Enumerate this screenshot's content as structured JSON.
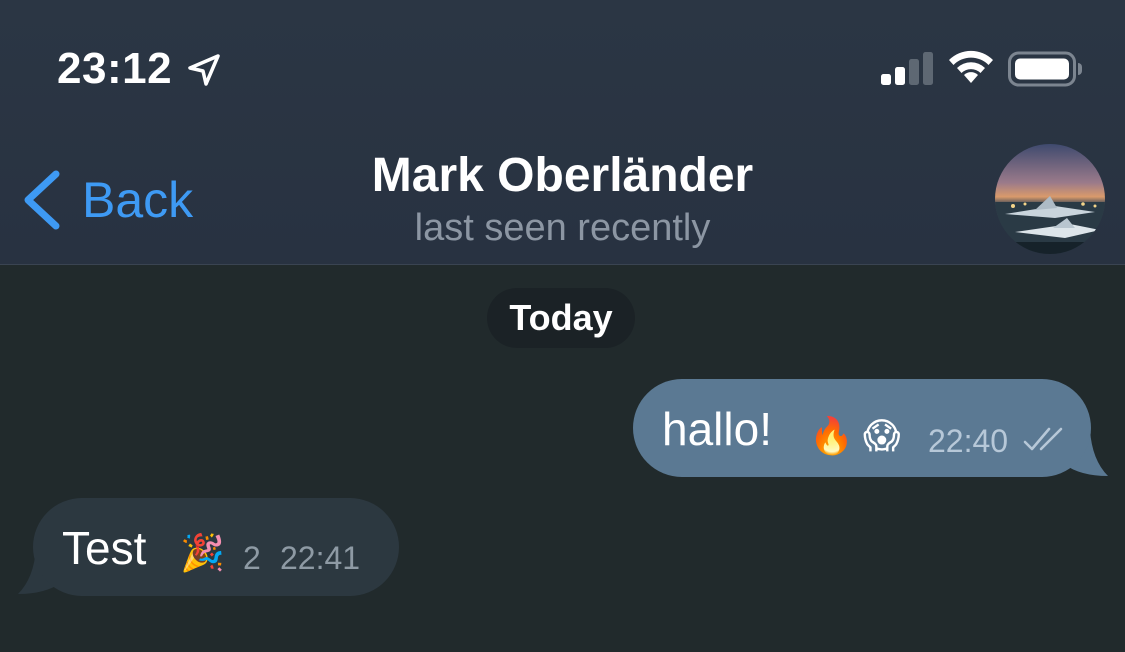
{
  "status_bar": {
    "time": "23:12",
    "icons": [
      "location-arrow-icon",
      "cellular-signal-icon",
      "wifi-icon",
      "battery-icon"
    ]
  },
  "nav": {
    "back_label": "Back",
    "title": "Mark Oberländer",
    "subtitle": "last seen recently",
    "avatar_icon": "contact-avatar-photo"
  },
  "date_separator": "Today",
  "messages": [
    {
      "direction": "outgoing",
      "text": "hallo!",
      "reactions": [
        "🔥",
        "😱"
      ],
      "time": "22:40",
      "status_icon": "double-check-icon"
    },
    {
      "direction": "incoming",
      "text": "Test",
      "reaction": "🎉",
      "reaction_count": "2",
      "time": "22:41"
    }
  ],
  "colors": {
    "background": "#212a2c",
    "header": "#2b3644",
    "accent": "#3e9af4",
    "outgoing_bubble": "#5b7993",
    "incoming_bubble": "#2c3840",
    "date_pill": "#1b2226"
  }
}
